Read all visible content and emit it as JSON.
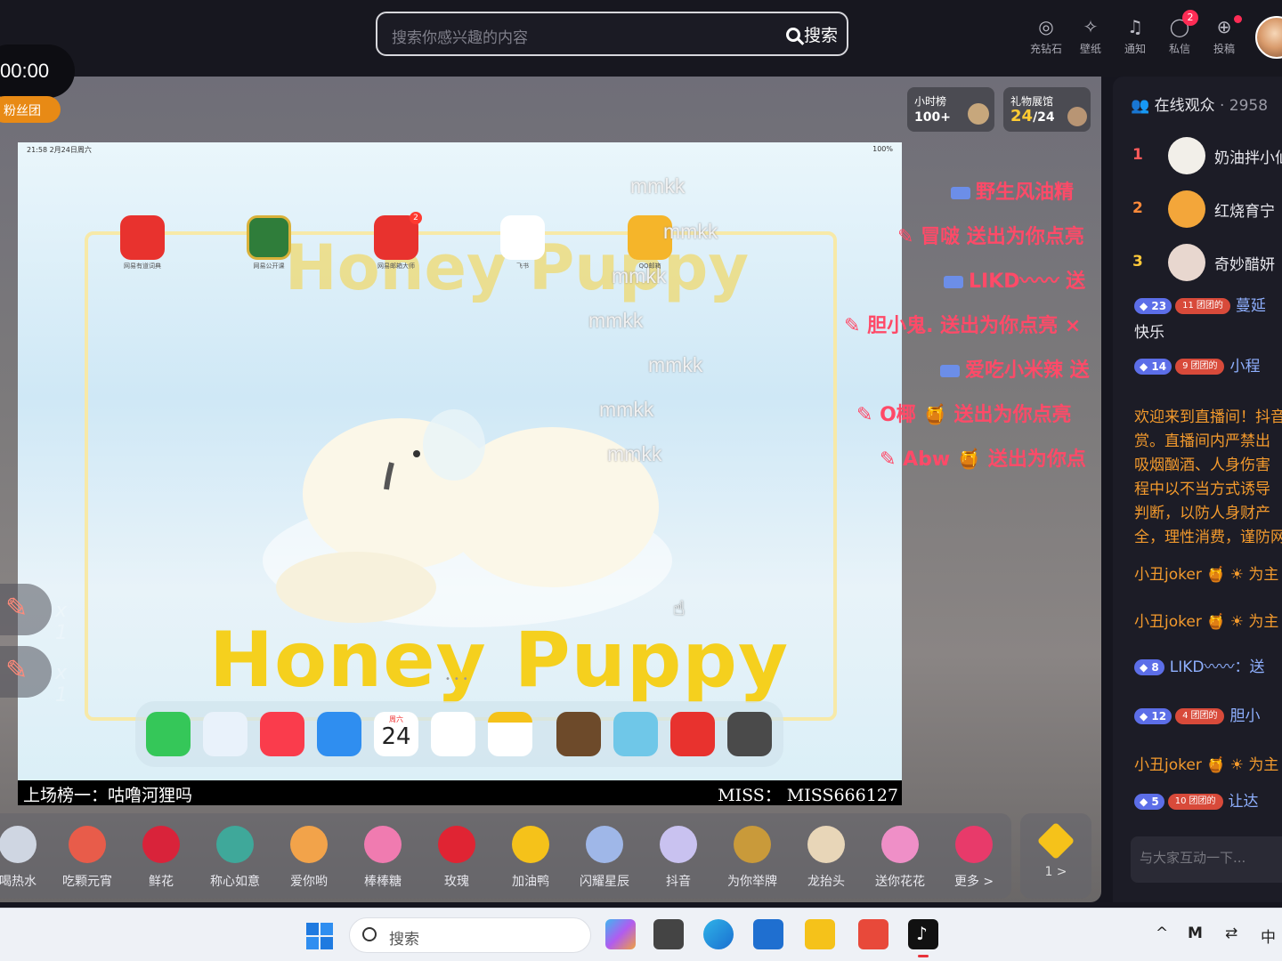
{
  "topbar": {
    "search_placeholder": "搜索你感兴趣的内容",
    "search_button": "搜索",
    "nav": [
      {
        "label": "充钻石",
        "icon": "diamond-icon"
      },
      {
        "label": "壁纸",
        "icon": "wallpaper-icon"
      },
      {
        "label": "通知",
        "icon": "bell-icon"
      },
      {
        "label": "私信",
        "icon": "message-icon",
        "badge": "2"
      },
      {
        "label": "投稿",
        "icon": "upload-icon"
      }
    ]
  },
  "stage": {
    "timer": "00:00",
    "fan_club": "粉丝团",
    "hour_rank": {
      "title": "小时榜",
      "value": "100+"
    },
    "gift_hall": {
      "title": "礼物展馆",
      "lit": "24",
      "total": "/24"
    },
    "caption_left": "上场榜一：咕噜河狸吗",
    "caption_right": "MISS： MISS666127",
    "ipad_status_time": "21:58  2月24日周六",
    "ipad_status_right": "100%",
    "wallpaper_title": "Honey Puppy",
    "apps": [
      {
        "name": "网易有道词典",
        "color": "#e8322e"
      },
      {
        "name": "网易公开课",
        "color": "#2f7d3a"
      },
      {
        "name": "网易邮箱大师",
        "color": "#e8322e",
        "badge": "2"
      },
      {
        "name": "飞书",
        "color": "#ffffff"
      },
      {
        "name": "QQ邮箱",
        "color": "#f5b52a"
      }
    ],
    "dock_date": {
      "weekday": "周六",
      "day": "24"
    },
    "danmu": [
      "mmkk",
      "mmkk",
      "mmkk",
      "mmkk",
      "mmkk",
      "mmkk",
      "mmkk"
    ],
    "effects": [
      "野生风油精",
      "冒啵 送出为你点亮",
      "LIKD〰〰 送",
      "胆小鬼. 送出为你点亮 ×",
      "爱吃小米辣 送",
      "O椰 🍯 送出为你点亮",
      "Abw 🍯 送出为你点"
    ],
    "side_gift_counts": [
      "x 1",
      "x 1"
    ]
  },
  "gifts": [
    "喝热水",
    "吃颗元宵",
    "鲜花",
    "称心如意",
    "爱你哟",
    "棒棒糖",
    "玫瑰",
    "加油鸭",
    "闪耀星辰",
    "抖音",
    "为你举牌",
    "龙抬头",
    "送你花花",
    "更多 >"
  ],
  "gift_colors": [
    "#cfd6e2",
    "#e85c4a",
    "#d9233a",
    "#3fa89a",
    "#f2a34a",
    "#f07bb0",
    "#e02433",
    "#f5c21a",
    "#9fb7e8",
    "#c9c2f0",
    "#c99a3a",
    "#e8d6b8",
    "#ef8fc7",
    "#e83a6a"
  ],
  "coin": {
    "label": "1 >"
  },
  "panel": {
    "title": "在线观众",
    "count": "2958",
    "viewers": [
      {
        "rank": "1",
        "name": "奶油拌小仙",
        "color": "#ff5a5a",
        "avatar": "#f2efe9"
      },
      {
        "rank": "2",
        "name": "红烧育宁",
        "color": "#ff8a3a",
        "avatar": "#f3a63a"
      },
      {
        "rank": "3",
        "name": "奇妙醋妍",
        "color": "#ffc93a",
        "avatar": "#e8d7cf"
      }
    ],
    "chat": [
      {
        "level": "23",
        "fan": "11",
        "text": "蔓延",
        "color": "#8fb0ff"
      },
      {
        "text": "快乐",
        "color": "#e8e8ee"
      },
      {
        "level": "14",
        "fan": "9",
        "text": "小程",
        "color": "#8fb0ff"
      }
    ],
    "fan_badge_text": "团团的",
    "system_lines": [
      "欢迎来到直播间！抖音",
      "赏。直播间内严禁出",
      "吸烟酗酒、人身伤害",
      "程中以不当方式诱导",
      "判断，以防人身财产",
      "全，理性消费，谨防网"
    ],
    "chat2": [
      {
        "text": "小丑joker 🍯 ☀ 为主",
        "color": "#f39a2d"
      },
      {
        "text": "小丑joker 🍯 ☀ 为主",
        "color": "#f39a2d"
      },
      {
        "level": "8",
        "text": "LIKD〰〰：送",
        "color": "#8fb0ff"
      },
      {
        "level": "12",
        "fan": "4",
        "text": "胆小",
        "color": "#8fb0ff"
      },
      {
        "text": "小丑joker 🍯 ☀ 为主",
        "color": "#f39a2d"
      },
      {
        "level": "5",
        "fan": "10",
        "text": "让达",
        "color": "#8fb0ff"
      }
    ],
    "input_placeholder": "与大家互动一下..."
  },
  "taskbar": {
    "search_placeholder": "搜索",
    "tray": [
      "^",
      "中"
    ]
  }
}
